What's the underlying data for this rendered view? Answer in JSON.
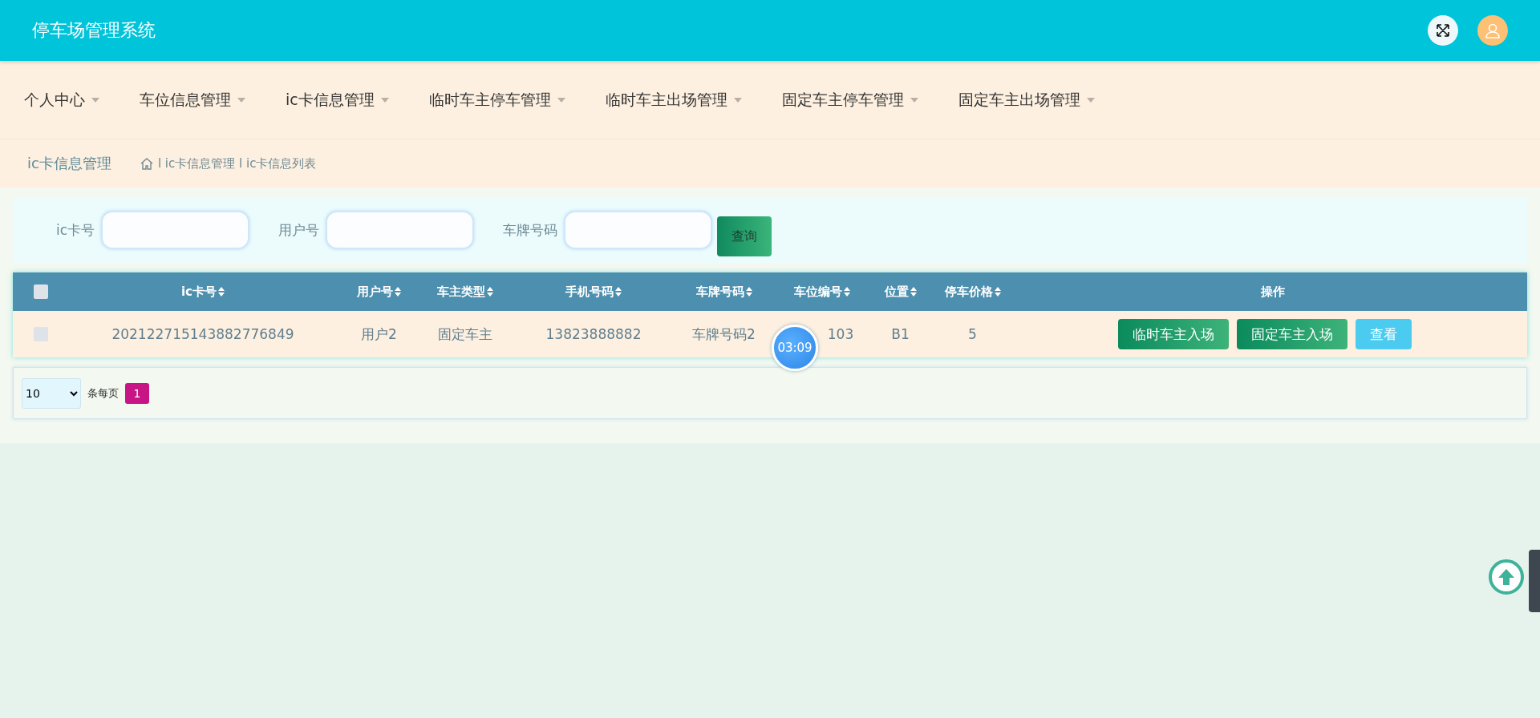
{
  "header": {
    "title": "停车场管理系统"
  },
  "nav": [
    {
      "label": "个人中心"
    },
    {
      "label": "车位信息管理"
    },
    {
      "label": "ic卡信息管理"
    },
    {
      "label": "临时车主停车管理"
    },
    {
      "label": "临时车主出场管理"
    },
    {
      "label": "固定车主停车管理"
    },
    {
      "label": "固定车主出场管理"
    }
  ],
  "breadcrumb": {
    "title": "ic卡信息管理",
    "path": "l ic卡信息管理 l ic卡信息列表"
  },
  "search": {
    "fields": [
      {
        "label": "ic卡号"
      },
      {
        "label": "用户号"
      },
      {
        "label": "车牌号码"
      }
    ],
    "button": "查询"
  },
  "table": {
    "columns": [
      "ic卡号",
      "用户号",
      "车主类型",
      "手机号码",
      "车牌号码",
      "车位编号",
      "位置",
      "停车价格",
      "操作"
    ],
    "all_checked": false,
    "rows": [
      {
        "checked": false,
        "cells": [
          "202122715143882776849",
          "用户2",
          "固定车主",
          "13823888882",
          "车牌号码2",
          "103",
          "B1",
          "5"
        ],
        "actions": [
          {
            "label": "临时车主入场",
            "kind": "green"
          },
          {
            "label": "固定车主入场",
            "kind": "green"
          },
          {
            "label": "查看",
            "kind": "blue"
          }
        ]
      }
    ]
  },
  "pagination": {
    "page_size": "10",
    "per_page_label": "条每页",
    "pages": [
      {
        "label": "1",
        "selected": true
      }
    ]
  },
  "timer": "03:09"
}
